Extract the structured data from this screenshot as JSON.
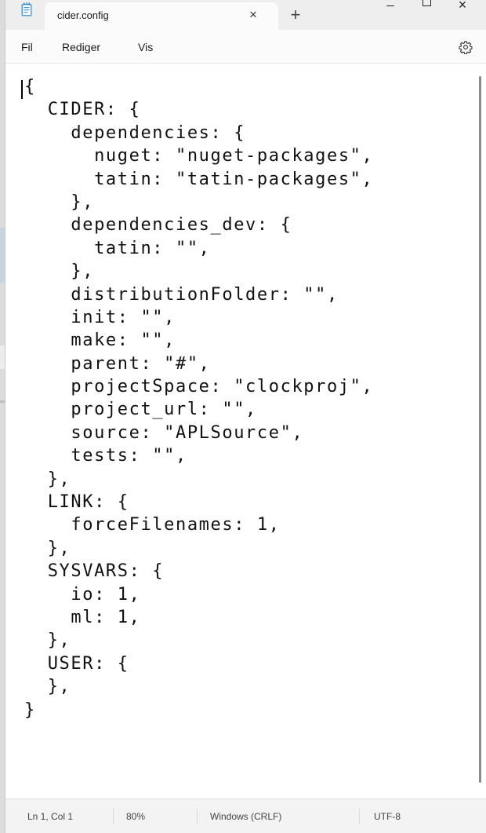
{
  "tab": {
    "title": "cider.config",
    "close_glyph": "×",
    "new_tab_glyph": "+"
  },
  "window_controls": {
    "close_glyph": "×"
  },
  "menu": {
    "items": [
      "Fil",
      "Rediger",
      "Vis"
    ],
    "settings_icon": "gear-icon"
  },
  "editor": {
    "lines": [
      "{",
      "  CIDER: {",
      "    dependencies: {",
      "      nuget: \"nuget-packages\",",
      "      tatin: \"tatin-packages\",",
      "    },",
      "    dependencies_dev: {",
      "      tatin: \"\",",
      "    },",
      "    distributionFolder: \"\",",
      "    init: \"\",",
      "    make: \"\",",
      "    parent: \"#\",",
      "    projectSpace: \"clockproj\",",
      "    project_url: \"\",",
      "    source: \"APLSource\",",
      "    tests: \"\",",
      "  },",
      "  LINK: {",
      "    forceFilenames: 1,",
      "  },",
      "  SYSVARS: {",
      "    io: 1,",
      "    ml: 1,",
      "  },",
      "  USER: {",
      "  },",
      "}"
    ]
  },
  "status": {
    "position": "Ln 1, Col 1",
    "zoom": "80%",
    "line_ending": "Windows (CRLF)",
    "encoding": "UTF-8"
  },
  "colors": {
    "accent": "#4f9fe0",
    "text": "#111111"
  }
}
